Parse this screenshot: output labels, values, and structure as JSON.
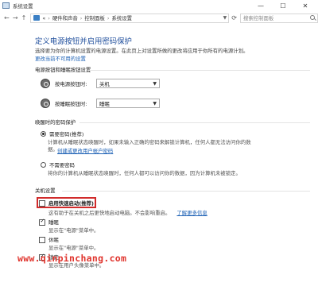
{
  "window": {
    "title": "系统设置",
    "minimize": "—",
    "maximize": "☐",
    "close": "✕"
  },
  "address": {
    "back": "←",
    "forward": "→",
    "up": "↑",
    "prefix": "«",
    "crumbs": [
      "硬件和声音",
      "控制面板",
      "系统设置"
    ],
    "separator": "›",
    "search_placeholder": "搜索控制面板"
  },
  "page": {
    "title": "定义电源按钮并启用密码保护",
    "subtitle": "选择要为你的计算机设置的电源设置。在此页上对设置所做的更改将应用于你所有的电源计划。",
    "change_link": "更改当前不可用的设置"
  },
  "buttons_section": {
    "title": "电源按钮和睡眠按钮设置",
    "rows": [
      {
        "label": "按电源按钮时:",
        "value": "关机"
      },
      {
        "label": "按睡眠按钮时:",
        "value": "睡眠"
      }
    ]
  },
  "password_section": {
    "title": "唤醒时的密码保护",
    "options": [
      {
        "label": "需要密码(推荐)",
        "checked": true,
        "desc1": "计算机从睡眠状态唤醒时，如果未输入正确的密码来解锁计算机，任何人都无法访问你的数",
        "desc2": "据。",
        "link": "创建或更改用户帐户密码"
      },
      {
        "label": "不需要密码",
        "checked": false,
        "desc1": "将你的计算机从睡眠状态唤醒时，任何人都可以访问你的数据，因为计算机未被锁定。"
      }
    ]
  },
  "shutdown_section": {
    "title": "关机设置",
    "items": [
      {
        "label": "启用快速启动(推荐)",
        "checked": false,
        "desc": "这有助于在关机之后更快地启动电脑。不会影响重启。",
        "link": "了解更多信息"
      },
      {
        "label": "睡眠",
        "checked": true,
        "desc": "显示在\"电源\"菜单中。"
      },
      {
        "label": "休眠",
        "checked": false,
        "desc": "显示在\"电源\"菜单中。"
      },
      {
        "label": "锁定",
        "checked": true,
        "desc": "显示在用户头像菜单中。"
      }
    ]
  },
  "watermark": "www.qinpinchang.com",
  "colors": {
    "title_blue": "#1f4e9c",
    "link_blue": "#1a5fb4",
    "highlight_red": "#d12b2b",
    "watermark_red": "#e0342d"
  }
}
